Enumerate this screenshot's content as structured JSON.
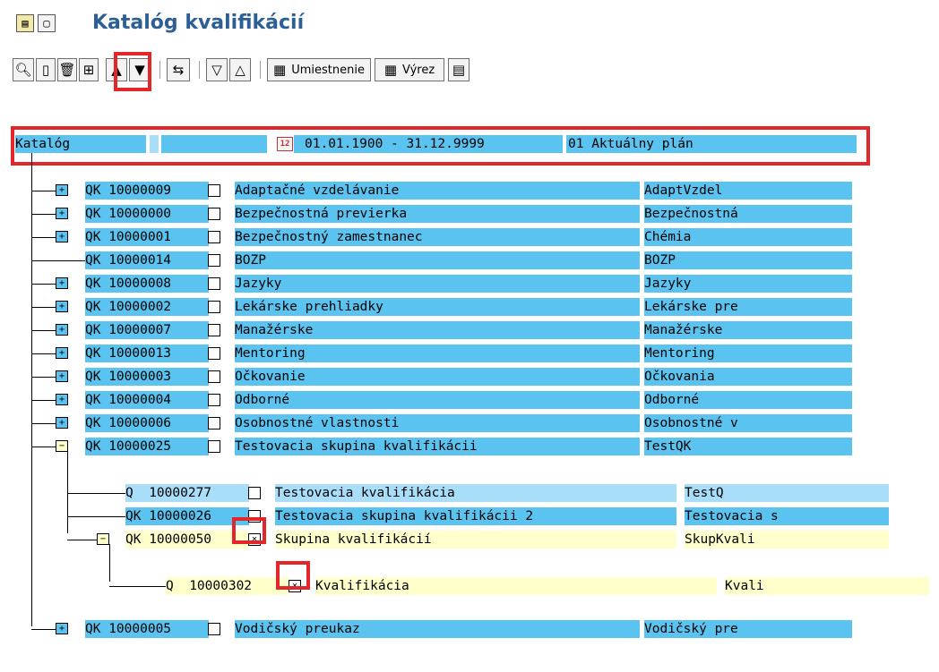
{
  "app": {
    "title": "Katalóg kvalifikácií"
  },
  "toolbar": {
    "placement_label": "Umiestnenie",
    "cut_label": "Výrez"
  },
  "header": {
    "catalog_label": "Katalóg",
    "date_range": "01.01.1900 - 31.12.9999",
    "plan_version": "01 Aktuálny plán"
  },
  "tree": [
    {
      "code": "QK 10000009",
      "name": "Adaptačné vzdelávanie",
      "short": "AdaptVzdel",
      "checked": false
    },
    {
      "code": "QK 10000000",
      "name": "Bezpečnostná previerka",
      "short": "Bezpečnostná",
      "checked": false
    },
    {
      "code": "QK 10000001",
      "name": "Bezpečnostný zamestnanec",
      "short": "Chémia",
      "checked": false
    },
    {
      "code": "QK 10000014",
      "name": "BOZP",
      "short": "BOZP",
      "checked": false
    },
    {
      "code": "QK 10000008",
      "name": "Jazyky",
      "short": "Jazyky",
      "checked": false
    },
    {
      "code": "QK 10000002",
      "name": "Lekárske prehliadky",
      "short": "Lekárske pre",
      "checked": false
    },
    {
      "code": "QK 10000007",
      "name": "Manažérske",
      "short": "Manažérske",
      "checked": false
    },
    {
      "code": "QK 10000013",
      "name": "Mentoring",
      "short": "Mentoring",
      "checked": false
    },
    {
      "code": "QK 10000003",
      "name": "Očkovanie",
      "short": "Očkovania",
      "checked": false
    },
    {
      "code": "QK 10000004",
      "name": "Odborné",
      "short": "Odborné",
      "checked": false
    },
    {
      "code": "QK 10000006",
      "name": "Osobnostné vlastnosti",
      "short": "Osobnostné v",
      "checked": false
    },
    {
      "code": "QK 10000025",
      "name": "Testovacia skupina kvalifikácii",
      "short": "TestQK",
      "checked": false
    },
    {
      "code": "Q  10000277",
      "name": "Testovacia kvalifikácia",
      "short": "TestQ",
      "checked": false
    },
    {
      "code": "QK 10000026",
      "name": "Testovacia skupina kvalifikácii 2",
      "short": "Testovacia s",
      "checked": false
    },
    {
      "code": "QK 10000050",
      "name": "Skupina kvalifikácií",
      "short": "SkupKvali",
      "checked": true
    },
    {
      "code": "Q  10000302",
      "name": "Kvalifikácia",
      "short": "Kvali",
      "checked": true
    },
    {
      "code": "QK 10000005",
      "name": "Vodičský preukaz",
      "short": "Vodičský pre",
      "checked": false
    }
  ],
  "glyphs": {
    "expand": "+",
    "collapse": "−",
    "check": "✕"
  },
  "colors": {
    "row_blue": "#5bc3f0",
    "row_light_blue": "#a9defa",
    "row_yellow": "#ffffcc",
    "highlight_red": "#e3262a",
    "title_blue": "#2c5f93"
  }
}
